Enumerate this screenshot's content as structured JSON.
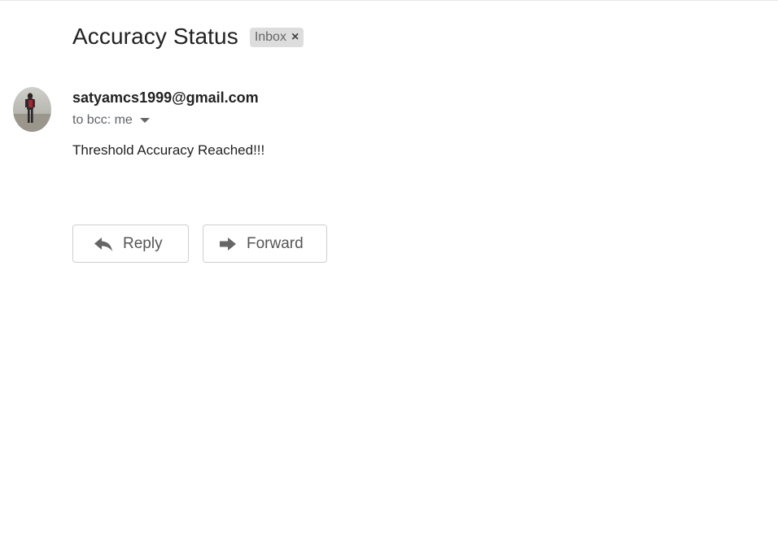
{
  "message": {
    "subject": "Accuracy Status",
    "label": {
      "text": "Inbox",
      "close_glyph": "×"
    },
    "sender": "satyamcs1999@gmail.com",
    "recipients": "to bcc: me",
    "body": "Threshold Accuracy Reached!!!"
  },
  "actions": {
    "reply_label": "Reply",
    "reply_icon": "reply-arrow-icon",
    "forward_label": "Forward",
    "forward_icon": "forward-arrow-icon"
  },
  "colors": {
    "chip_background": "#dddddd",
    "button_border": "#cfcfcf",
    "secondary_text": "#5f6368"
  }
}
